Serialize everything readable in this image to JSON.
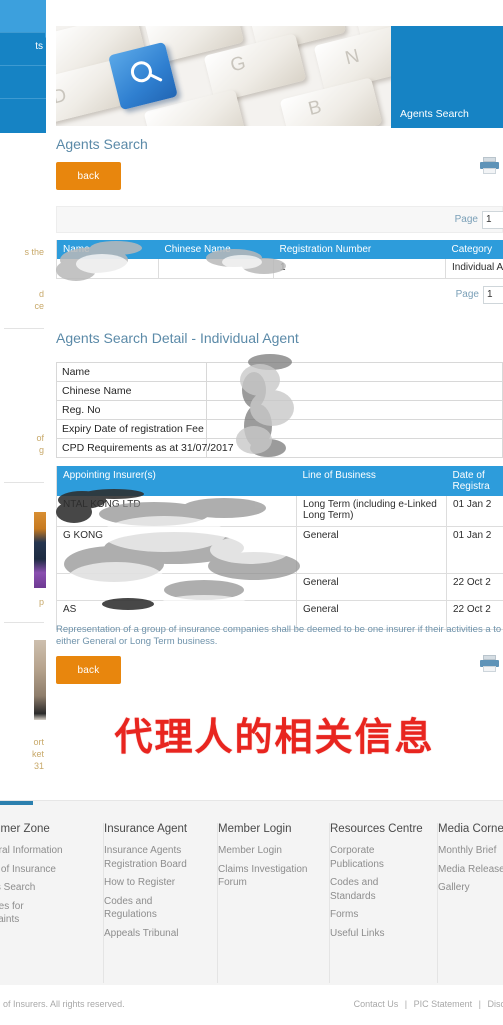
{
  "sidebar": {
    "nav_items": [
      {
        "label": "",
        "active": true
      },
      {
        "label": "ts",
        "active": false
      },
      {
        "label": "",
        "active": false
      },
      {
        "label": "",
        "active": false
      }
    ],
    "clipped_texts": [
      "s the",
      "d\nce",
      "of\ng",
      "p",
      "ort\nket\n31"
    ]
  },
  "hero": {
    "tab_label": "Agents Search",
    "keycaps": [
      "D",
      "G",
      "N",
      "B"
    ]
  },
  "main": {
    "page_title": "Agents Search",
    "back_label": "back",
    "printer_icon": "printer-icon",
    "pagination_top": {
      "label": "Page",
      "value": "1"
    },
    "pagination_bottom": {
      "label": "Page",
      "value": "1"
    },
    "results_table": {
      "headers": [
        "Name",
        "Chinese Name",
        "Registration Number",
        "Category"
      ],
      "rows": [
        {
          "name": "",
          "chinese_name": "",
          "registration_number": "1",
          "category": "Individual Agent"
        }
      ]
    },
    "detail_title": "Agents Search Detail - Individual Agent",
    "detail_rows": [
      {
        "label": "Name",
        "value": ""
      },
      {
        "label": "Chinese Name",
        "value": ""
      },
      {
        "label": "Reg. No",
        "value": ""
      },
      {
        "label": "Expiry Date of registration Fee",
        "value": ""
      },
      {
        "label": "CPD Requirements as at 31/07/2017",
        "value": ""
      }
    ],
    "insurer_table": {
      "headers": [
        "Appointing Insurer(s)",
        "Line of Business",
        "Date of Registra"
      ],
      "rows": [
        {
          "insurer": "NTAL      KONG LTD",
          "line": "Long Term (including e-Linked Long Term)",
          "date": "01 Jan 2"
        },
        {
          "insurer": "G KONG",
          "line": "General",
          "date": "01 Jan 2"
        },
        {
          "insurer": "",
          "line": "General",
          "date": "22 Oct 2"
        },
        {
          "insurer": "AS",
          "line": "General",
          "date": "22 Oct 2"
        }
      ]
    },
    "note": "Representation of a group of insurance companies shall be deemed to be one insurer if their activities a to either General or Long Term business.",
    "back_label_bottom": "back",
    "caption_cn": "代理人的相关信息"
  },
  "footer": {
    "columns": [
      {
        "title": "nsumer Zone",
        "links": [
          "eneral Information",
          "pes of Insurance",
          "ents Search",
          "enues for",
          "mplaints"
        ]
      },
      {
        "title": "Insurance Agent",
        "links": [
          "Insurance Agents",
          "Registration Board",
          "How to Register",
          "Codes and",
          "Regulations",
          "Appeals Tribunal"
        ]
      },
      {
        "title": "Member Login",
        "links": [
          "Member Login",
          "Claims Investigation",
          "Forum"
        ]
      },
      {
        "title": "Resources Centre",
        "links": [
          "Corporate",
          "Publications",
          "Codes and",
          "Standards",
          "Forms",
          "Useful Links"
        ]
      },
      {
        "title": "Media Corne",
        "links": [
          "Monthly Brief",
          "Media Release",
          "Gallery"
        ]
      }
    ],
    "copyright": "deration of Insurers. All rights reserved.",
    "legal_links": [
      "Contact Us",
      "PIC Statement",
      "Disclaimer & Priva"
    ]
  },
  "colors": {
    "brand_blue": "#1683c4",
    "table_header_blue": "#2d9cdb",
    "accent_orange": "#e8860d",
    "heading_blue": "#5b8aa8",
    "caption_red": "#e8251f"
  }
}
